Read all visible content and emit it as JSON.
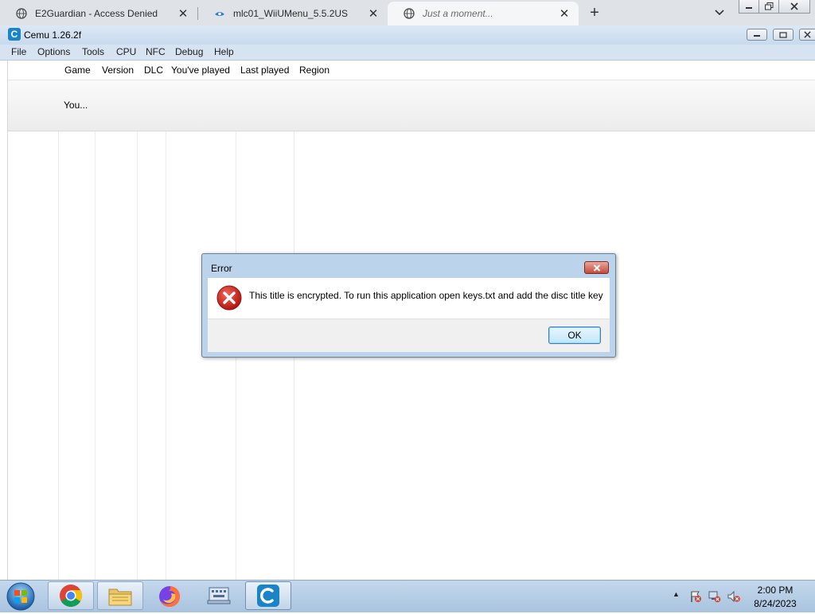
{
  "browser": {
    "tabs": [
      {
        "title": "E2Guardian - Access Denied",
        "icon": "globe-icon"
      },
      {
        "title": "mlc01_WiiUMenu_5.5.2US",
        "icon": "cemu-site-icon"
      },
      {
        "title": "Just a moment...",
        "icon": "globe-icon",
        "active": true
      }
    ],
    "new_tab_label": "+",
    "close_glyph": "✕"
  },
  "cemu": {
    "title": "Cemu 1.26.2f",
    "logo_letter": "C",
    "accent_color": "#1b84c7",
    "menu": [
      "File",
      "Options",
      "Tools",
      "CPU",
      "NFC",
      "Debug",
      "Help"
    ],
    "columns": [
      "Game",
      "Version",
      "DLC",
      "You've played",
      "Last played",
      "Region"
    ],
    "row_text": "You..."
  },
  "dialog": {
    "title": "Error",
    "message": "This title is encrypted. To run this application open keys.txt and add the disc title key",
    "ok_label": "OK",
    "icon": "error-icon"
  },
  "taskbar": {
    "apps": [
      "start-orb-icon",
      "chrome-icon",
      "file-explorer-icon",
      "firefox-icon",
      "on-screen-keyboard-icon",
      "cemu-icon"
    ],
    "clock_time": "2:00 PM",
    "clock_date": "8/24/2023",
    "tray_arrow": "▲"
  }
}
